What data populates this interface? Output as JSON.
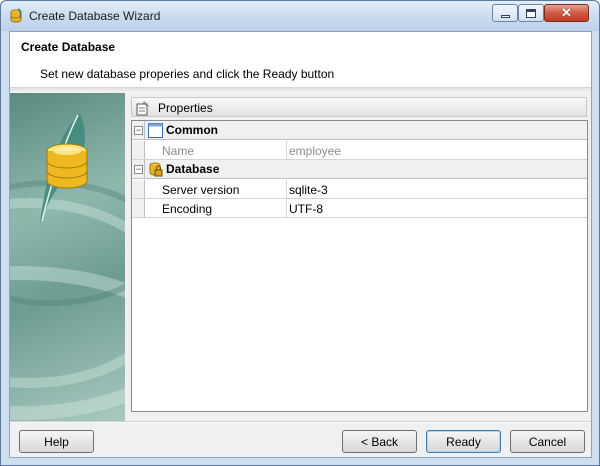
{
  "window": {
    "title": "Create Database Wizard"
  },
  "header": {
    "title": "Create Database",
    "subtitle": "Set new database properies and click the Ready button"
  },
  "properties": {
    "label": "Properties",
    "categories": [
      {
        "label": "Common",
        "toggle": "−",
        "rows": [
          {
            "name": "Name",
            "value": "employee",
            "enabled": false
          }
        ]
      },
      {
        "label": "Database",
        "toggle": "−",
        "rows": [
          {
            "name": "Server version",
            "value": "sqlite-3",
            "enabled": true
          },
          {
            "name": "Encoding",
            "value": "UTF-8",
            "enabled": true
          }
        ]
      }
    ]
  },
  "buttons": {
    "help": "Help",
    "back": "< Back",
    "ready": "Ready",
    "cancel": "Cancel"
  },
  "window_controls": {
    "close": "✕"
  },
  "colors": {
    "title_bar": "#c9dbef",
    "close_button": "#c23a24",
    "side_panel": "#8fb8ad",
    "default_button_border": "#3c7fb1"
  }
}
